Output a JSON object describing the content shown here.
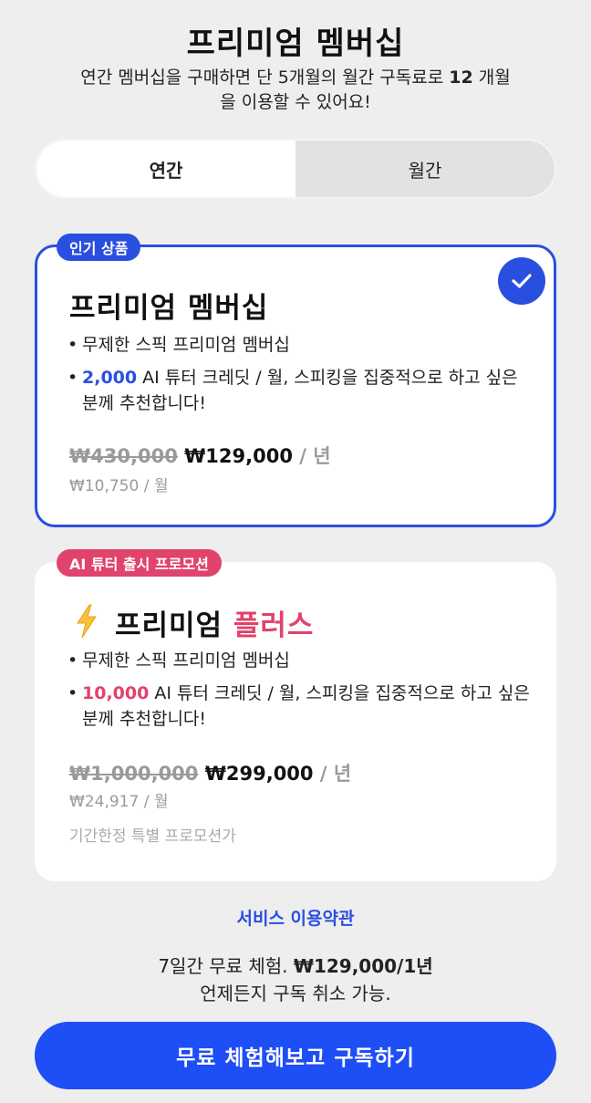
{
  "header": {
    "title": "프리미엄 멤버십",
    "subtitle_pre": "연간 멤버십을 구매하면 단 5개월의 월간 구독료로 ",
    "subtitle_bold": "12",
    "subtitle_post": " 개월",
    "subtitle_line2": "을 이용할 수 있어요!"
  },
  "toggle": {
    "options": [
      "연간",
      "월간"
    ],
    "selected": "연간"
  },
  "colors": {
    "accent": "#2a4fe0",
    "promo": "#e0436b",
    "cta": "#1e4ef5"
  },
  "plans": [
    {
      "badge": "인기 상품",
      "selected": true,
      "check_icon": "check-icon",
      "name": "프리미엄 멤버십",
      "bullets": [
        {
          "text": "무제한 스픽 프리미엄 멤버십"
        },
        {
          "highlight": "2,000",
          "text": " AI 튜터 크레딧 / 월, 스피킹을 집중적으로 하고 싶은 분께 추천합니다!"
        }
      ],
      "old_price": "₩430,000",
      "price": "₩129,000",
      "period": " / 년",
      "monthly": "₩10,750 / 월"
    },
    {
      "badge": "AI 튜터 출시 프로모션",
      "selected": false,
      "icon": "lightning-icon",
      "name_main": "프리미엄 ",
      "name_accent": "플러스",
      "bullets": [
        {
          "text": "무제한 스픽 프리미엄 멤버십"
        },
        {
          "highlight": "10,000",
          "text": " AI 튜터 크레딧 / 월, 스피킹을 집중적으로 하고 싶은 분께 추천합니다!"
        }
      ],
      "old_price": "₩1,000,000",
      "price": "₩299,000",
      "period": " / 년",
      "monthly": "₩24,917 / 월",
      "note": "기간한정 특별 프로모션가"
    }
  ],
  "terms_link": "서비스 이용약관",
  "trial": {
    "line1_pre": "7일간 무료 체험. ",
    "line1_bold": "₩129,000/1년",
    "line2": "언제든지 구독 취소 가능."
  },
  "cta_label": "무료 체험해보고 구독하기"
}
